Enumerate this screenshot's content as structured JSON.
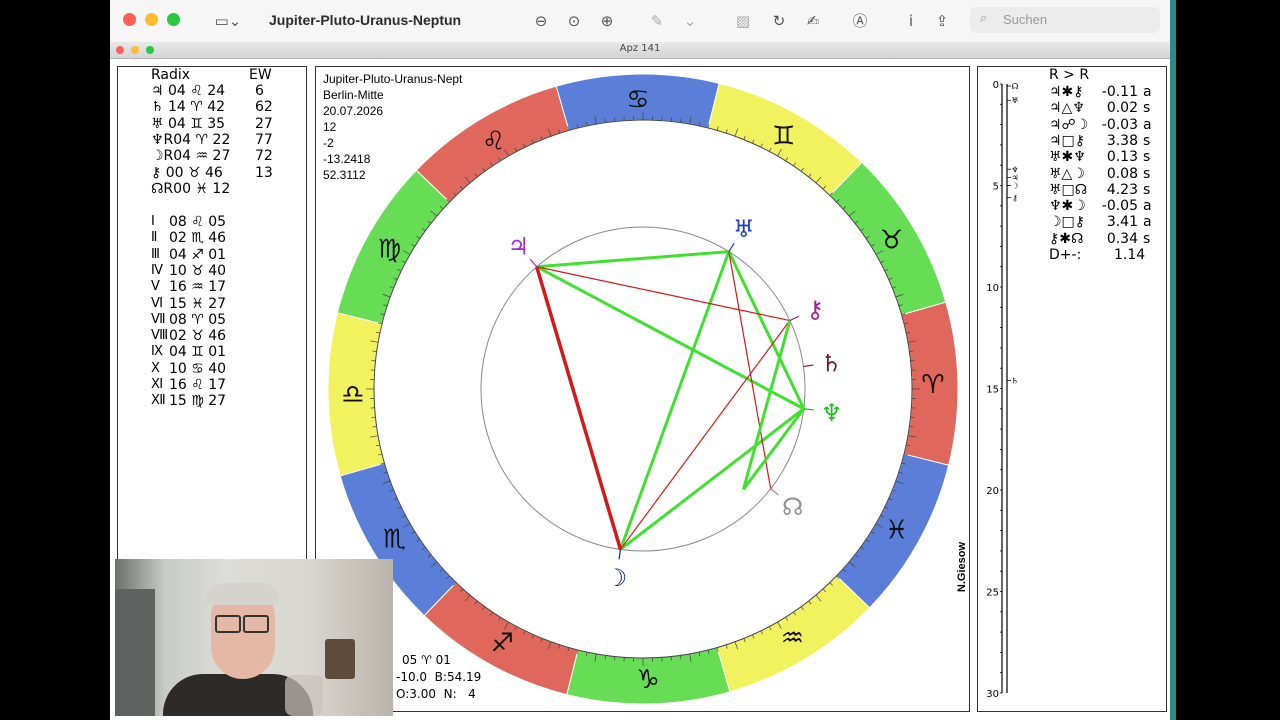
{
  "app": {
    "document_title": "Jupiter-Pluto-Uranus-Neptun",
    "search_placeholder": "Suchen",
    "inner_window_title": "Apz 141"
  },
  "left_panel": {
    "header_left": "Radix",
    "header_right": "EW",
    "planets": [
      {
        "text": "♃ 04 ♌ 24",
        "ew": "6"
      },
      {
        "text": "♄ 14 ♈ 42",
        "ew": "62"
      },
      {
        "text": "♅ 04 ♊ 35",
        "ew": "27"
      },
      {
        "text": "♆R04 ♈ 22",
        "ew": "77"
      },
      {
        "text": "☽R04 ♒ 27",
        "ew": "72"
      },
      {
        "text": "⚷ 00 ♉ 46",
        "ew": "13"
      },
      {
        "text": "☊R00 ♓ 12",
        "ew": ""
      }
    ],
    "houses": [
      {
        "num": "Ⅰ",
        "val": "08 ♌ 05"
      },
      {
        "num": "Ⅱ",
        "val": "02 ♏ 46"
      },
      {
        "num": "Ⅲ",
        "val": "04 ♐ 01"
      },
      {
        "num": "Ⅳ",
        "val": "10 ♉ 40"
      },
      {
        "num": "Ⅴ",
        "val": "16 ♒ 17"
      },
      {
        "num": "Ⅵ",
        "val": "15 ♓ 27"
      },
      {
        "num": "Ⅶ",
        "val": "08 ♈ 05"
      },
      {
        "num": "Ⅷ",
        "val": "02 ♉ 46"
      },
      {
        "num": "Ⅸ",
        "val": "04 ♊ 01"
      },
      {
        "num": "Ⅹ",
        "val": "10 ♋ 40"
      },
      {
        "num": "Ⅺ",
        "val": "16 ♌ 17"
      },
      {
        "num": "Ⅻ",
        "val": "15 ♍ 27"
      }
    ]
  },
  "chart_info": {
    "name": "Jupiter-Pluto-Uranus-Nept",
    "place": "Berlin-Mitte",
    "date": "20.07.2026",
    "hour": "12",
    "tz": "-2",
    "lon": "-13.2418",
    "lat": "52.3112",
    "bottom_line1": "05 ♈ 01",
    "bottom_line2": "-10.0  B:54.19",
    "bottom_line3": "O:3.00  N:   4",
    "author": "N.Giesow"
  },
  "zodiac_signs": [
    {
      "glyph": "♋",
      "color": "#5b7fd9"
    },
    {
      "glyph": "♊",
      "color": "#f2f25e"
    },
    {
      "glyph": "♉",
      "color": "#66dd55"
    },
    {
      "glyph": "♈",
      "color": "#e0675c"
    },
    {
      "glyph": "♓",
      "color": "#5b7fd9"
    },
    {
      "glyph": "♒",
      "color": "#f2f25e"
    },
    {
      "glyph": "♑",
      "color": "#66dd55"
    },
    {
      "glyph": "♐",
      "color": "#e0675c"
    },
    {
      "glyph": "♏",
      "color": "#5b7fd9"
    },
    {
      "glyph": "♎",
      "color": "#f2f25e"
    },
    {
      "glyph": "♍",
      "color": "#66dd55"
    },
    {
      "glyph": "♌",
      "color": "#e0675c"
    }
  ],
  "planets_on_wheel": [
    {
      "name": "jupiter",
      "glyph": "♃",
      "color": "#9b30d0"
    },
    {
      "name": "uranus",
      "glyph": "♅",
      "color": "#1a3cc8"
    },
    {
      "name": "chiron",
      "glyph": "⚷",
      "color": "#a020a0"
    },
    {
      "name": "saturn",
      "glyph": "♄",
      "color": "#6a1a2a"
    },
    {
      "name": "neptune",
      "glyph": "♆",
      "color": "#22b822"
    },
    {
      "name": "node",
      "glyph": "☊",
      "color": "#909090"
    },
    {
      "name": "moon",
      "glyph": "☽",
      "color": "#0a1a8a"
    }
  ],
  "right_panel": {
    "header": "R > R",
    "aspects": [
      {
        "pair": "♃✱⚷",
        "value": "-0.11",
        "flag": "a"
      },
      {
        "pair": "♃△♆",
        "value": "0.02",
        "flag": "s"
      },
      {
        "pair": "♃☍☽",
        "value": "-0.03",
        "flag": "a"
      },
      {
        "pair": "♃□⚷",
        "value": "3.38",
        "flag": "s"
      },
      {
        "pair": "♅✱♆",
        "value": "0.13",
        "flag": "s"
      },
      {
        "pair": "♅△☽",
        "value": "0.08",
        "flag": "s"
      },
      {
        "pair": "♅□☊",
        "value": "4.23",
        "flag": "s"
      },
      {
        "pair": "♆✱☽",
        "value": "-0.05",
        "flag": "a"
      },
      {
        "pair": "☽□⚷",
        "value": "3.41",
        "flag": "a"
      },
      {
        "pair": "⚷✱☊",
        "value": "0.34",
        "flag": "s"
      }
    ],
    "summary_label": "D+-:",
    "summary_value": "1.14",
    "scale_labels": [
      "0",
      "5",
      "10",
      "15",
      "20",
      "25",
      "30"
    ],
    "scale_glyphs": [
      "☊",
      "♅",
      "♆",
      "♃",
      "☽",
      "⚷",
      "♄"
    ]
  }
}
